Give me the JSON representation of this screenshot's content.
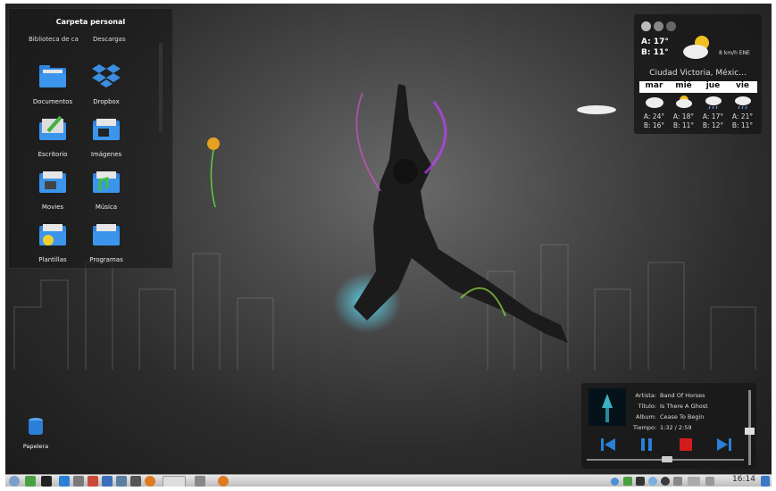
{
  "folderview": {
    "title": "Carpeta personal",
    "top_items": [
      "Biblioteca de ca",
      "Descargas"
    ],
    "items": [
      {
        "label": "Documentos",
        "icon": "folder-documents-icon"
      },
      {
        "label": "Dropbox",
        "icon": "dropbox-icon"
      },
      {
        "label": "Escritorio",
        "icon": "folder-desktop-icon"
      },
      {
        "label": "Imágenes",
        "icon": "folder-images-icon"
      },
      {
        "label": "Movies",
        "icon": "folder-movies-icon"
      },
      {
        "label": "Música",
        "icon": "folder-music-icon"
      },
      {
        "label": "Plantillas",
        "icon": "folder-templates-icon"
      },
      {
        "label": "Programas",
        "icon": "folder-programs-icon"
      }
    ]
  },
  "weather": {
    "high": "A: 17°",
    "low": "B: 11°",
    "wind": "8 km/h ENE",
    "city": "Ciudad Victoria, Méxic...",
    "days": [
      "mar",
      "mié",
      "jue",
      "vie"
    ],
    "forecast": [
      {
        "high": "A: 24°",
        "low": "B: 16°",
        "icon": "cloudy-icon"
      },
      {
        "high": "A: 18°",
        "low": "B: 11°",
        "icon": "partly-cloudy-icon"
      },
      {
        "high": "A: 17°",
        "low": "B: 12°",
        "icon": "rain-icon"
      },
      {
        "high": "A: 21°",
        "low": "B: 11°",
        "icon": "rain-icon"
      }
    ]
  },
  "trash": {
    "label": "Papelera"
  },
  "player": {
    "artist_label": "Artista:",
    "artist": "Band Of Horses",
    "title_label": "Título:",
    "title": "Is There A Ghost",
    "album_label": "Album:",
    "album": "Cease To Begin",
    "time_label": "Tiempo:",
    "time": "1:32 / 2:59",
    "progress": 0.51,
    "volume": 0.45
  },
  "taskbar": {
    "clock": "16:14"
  },
  "colors": {
    "accent": "#2a7fd6",
    "stop": "#d21c1c",
    "folder": "#3a8de0"
  }
}
